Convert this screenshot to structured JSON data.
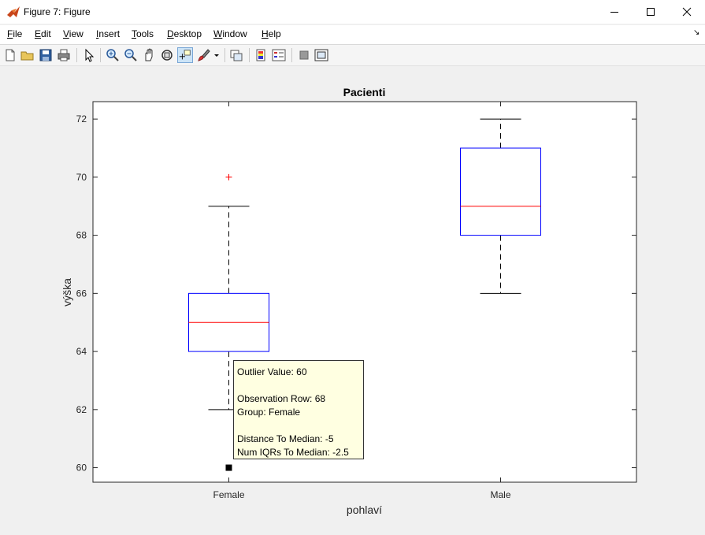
{
  "window": {
    "title": "Figure 7: Figure",
    "minimize_label": "—",
    "maximize_label": "☐",
    "close_label": "✕"
  },
  "menu": {
    "items": [
      {
        "label": "File",
        "key": "F",
        "rest": "ile"
      },
      {
        "label": "Edit",
        "key": "E",
        "rest": "dit"
      },
      {
        "label": "View",
        "key": "V",
        "rest": "iew"
      },
      {
        "label": "Insert",
        "key": "I",
        "rest": "nsert"
      },
      {
        "label": "Tools",
        "key": "T",
        "rest": "ools"
      },
      {
        "label": "Desktop",
        "key": "D",
        "rest": "esktop"
      },
      {
        "label": "Window",
        "key": "W",
        "rest": "indow"
      },
      {
        "label": "Help",
        "key": "H",
        "rest": "elp"
      }
    ],
    "dock_glyph": "↘"
  },
  "toolbar": {
    "icons": [
      "new-figure-icon",
      "open-file-icon",
      "save-icon",
      "print-icon",
      "edit-plot-icon",
      "zoom-in-icon",
      "zoom-out-icon",
      "pan-icon",
      "rotate-3d-icon",
      "data-cursor-icon",
      "brush-icon",
      "link-plot-icon",
      "colorbar-icon",
      "legend-icon",
      "hide-plot-tools-icon",
      "show-plot-tools-icon"
    ],
    "active": "data-cursor-icon"
  },
  "chart_data": {
    "type": "boxplot",
    "title": "Pacienti",
    "xlabel": "pohlaví",
    "ylabel": "výška",
    "categories": [
      "Female",
      "Male"
    ],
    "ylim": [
      59.5,
      72.6
    ],
    "yticks": [
      60,
      62,
      64,
      66,
      68,
      70,
      72
    ],
    "grid": false,
    "boxes": [
      {
        "group": "Female",
        "whisker_low": 62,
        "q1": 64,
        "median": 65,
        "q3": 66,
        "whisker_high": 69,
        "outliers": [
          70,
          60
        ]
      },
      {
        "group": "Male",
        "whisker_low": 66,
        "q1": 68,
        "median": 69,
        "q3": 71,
        "whisker_high": 72,
        "outliers": []
      }
    ],
    "colors": {
      "box": "#0000ff",
      "median": "#ff0000",
      "outlier": "#ff0000",
      "whisker": "#000000"
    },
    "selected_point": {
      "group": "Female",
      "value": 60
    }
  },
  "datatip": {
    "line1": "Outlier Value: 60",
    "line2": "Observation Row: 68",
    "line3": "Group: Female",
    "line4": "Distance To Median: -5",
    "line5": "Num IQRs To Median: -2.5"
  }
}
